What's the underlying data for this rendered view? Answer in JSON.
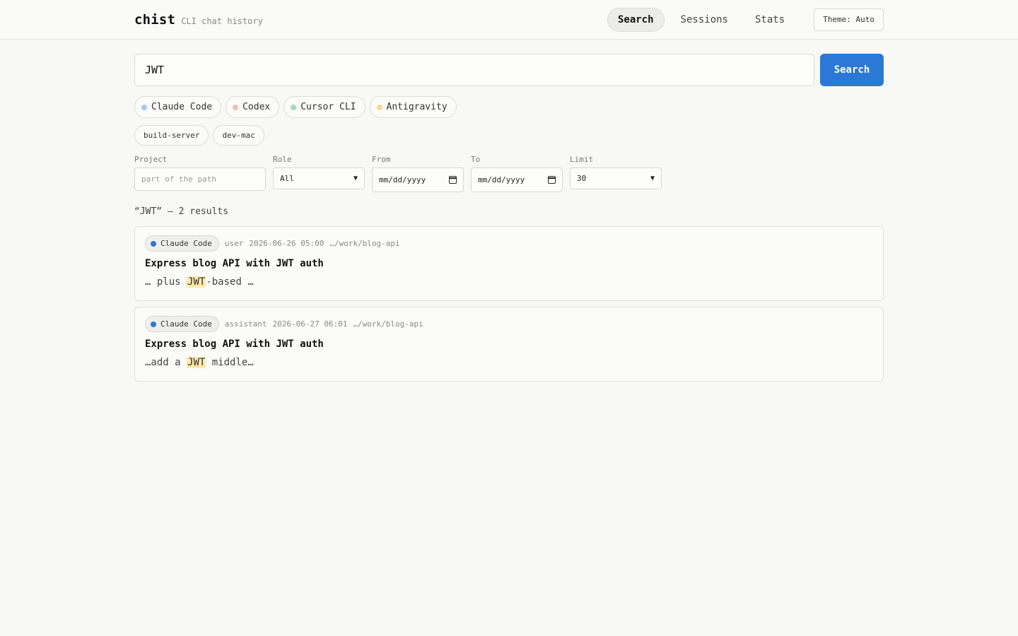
{
  "app": {
    "name": "chist",
    "subtitle": "CLI chat history"
  },
  "nav": [
    {
      "label": "Search",
      "active": true
    },
    {
      "label": "Sessions",
      "active": false
    },
    {
      "label": "Stats",
      "active": false
    }
  ],
  "theme_button": "Theme: Auto",
  "search": {
    "value": "JWT",
    "button": "Search"
  },
  "sources": [
    {
      "label": "Claude Code",
      "color": "#a9c8ef"
    },
    {
      "label": "Codex",
      "color": "#ecc0b1"
    },
    {
      "label": "Cursor CLI",
      "color": "#9fd9c2"
    },
    {
      "label": "Antigravity",
      "color": "#f3d993"
    }
  ],
  "hosts": [
    "build-server",
    "dev-mac"
  ],
  "filters": {
    "project": {
      "label": "Project",
      "placeholder": "part of the path"
    },
    "role": {
      "label": "Role",
      "value": "All"
    },
    "from": {
      "label": "From",
      "value": "mm/dd/yyyy"
    },
    "to": {
      "label": "To",
      "value": "mm/dd/yyyy"
    },
    "limit": {
      "label": "Limit",
      "value": "30"
    }
  },
  "result_summary": "“JWT” — 2 results",
  "results": [
    {
      "tool": "Claude Code",
      "tool_color": "#2b78d6",
      "role": "user",
      "timestamp": "2026-06-26 05:00",
      "path": "…/work/blog-api",
      "title": "Express blog API with JWT auth",
      "snippet_before": "… plus ",
      "snippet_match": "JWT",
      "snippet_after": "-based …"
    },
    {
      "tool": "Claude Code",
      "tool_color": "#2b78d6",
      "role": "assistant",
      "timestamp": "2026-06-27 06:01",
      "path": "…/work/blog-api",
      "title": "Express blog API with JWT auth",
      "snippet_before": "…add a ",
      "snippet_match": "JWT",
      "snippet_after": " middle…"
    }
  ]
}
